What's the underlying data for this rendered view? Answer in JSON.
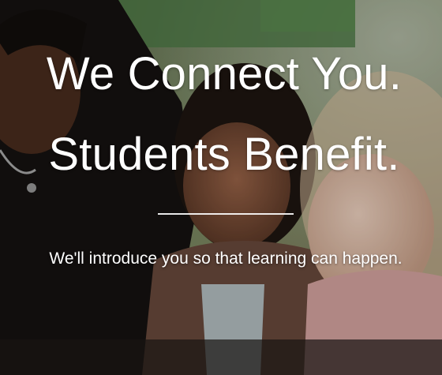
{
  "hero": {
    "headline_line1": "We Connect You.",
    "headline_line2": "Students Benefit.",
    "tagline": "We'll introduce you so that learning can happen."
  },
  "colors": {
    "text": "#ffffff",
    "overlay": "rgba(0,0,0,0.18)",
    "background_dark": "#1c1916",
    "classroom_green": "#5c7a52",
    "skin_dark": "#5a3a28",
    "skin_medium": "#8a5a3e",
    "skin_light": "#d8b8a0",
    "shirt_pink": "#d8a6a6",
    "shirt_brown": "#6b4a3a"
  }
}
